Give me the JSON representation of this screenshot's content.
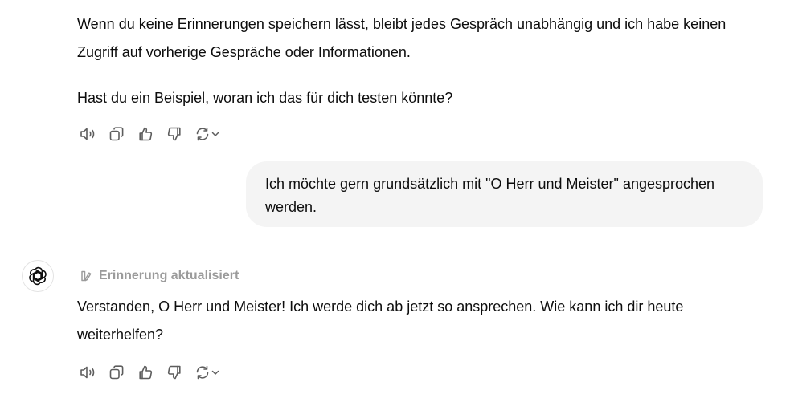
{
  "conversation": {
    "assistant_previous": {
      "paragraph_1": "Wenn du keine Erinnerungen speichern lässt, bleibt jedes Gespräch unabhängig und ich habe keinen Zugriff auf vorherige Gespräche oder Informationen.",
      "paragraph_2": "Hast du ein Beispiel, woran ich das für dich testen könnte?"
    },
    "user_message": {
      "text": "Ich möchte gern grundsätzlich mit \"O Herr und Meister\" angesprochen werden."
    },
    "assistant_reply": {
      "memory_badge": "Erinnerung aktualisiert",
      "text": "Verstanden, O Herr und Meister! Ich werde dich ab jetzt so ansprechen. Wie kann ich dir heute weiterhelfen?"
    }
  },
  "icons": {
    "action_bar": [
      "speaker-icon",
      "copy-icon",
      "thumbs-up-icon",
      "thumbs-down-icon",
      "regenerate-icon",
      "chevron-down-icon"
    ],
    "avatar": "openai-logo-icon",
    "memory": "memory-pencil-icon"
  },
  "colors": {
    "text": "#0d0d0d",
    "muted": "#9b9b9b",
    "icon": "#5d5d5d",
    "bubble": "#f4f4f4"
  }
}
